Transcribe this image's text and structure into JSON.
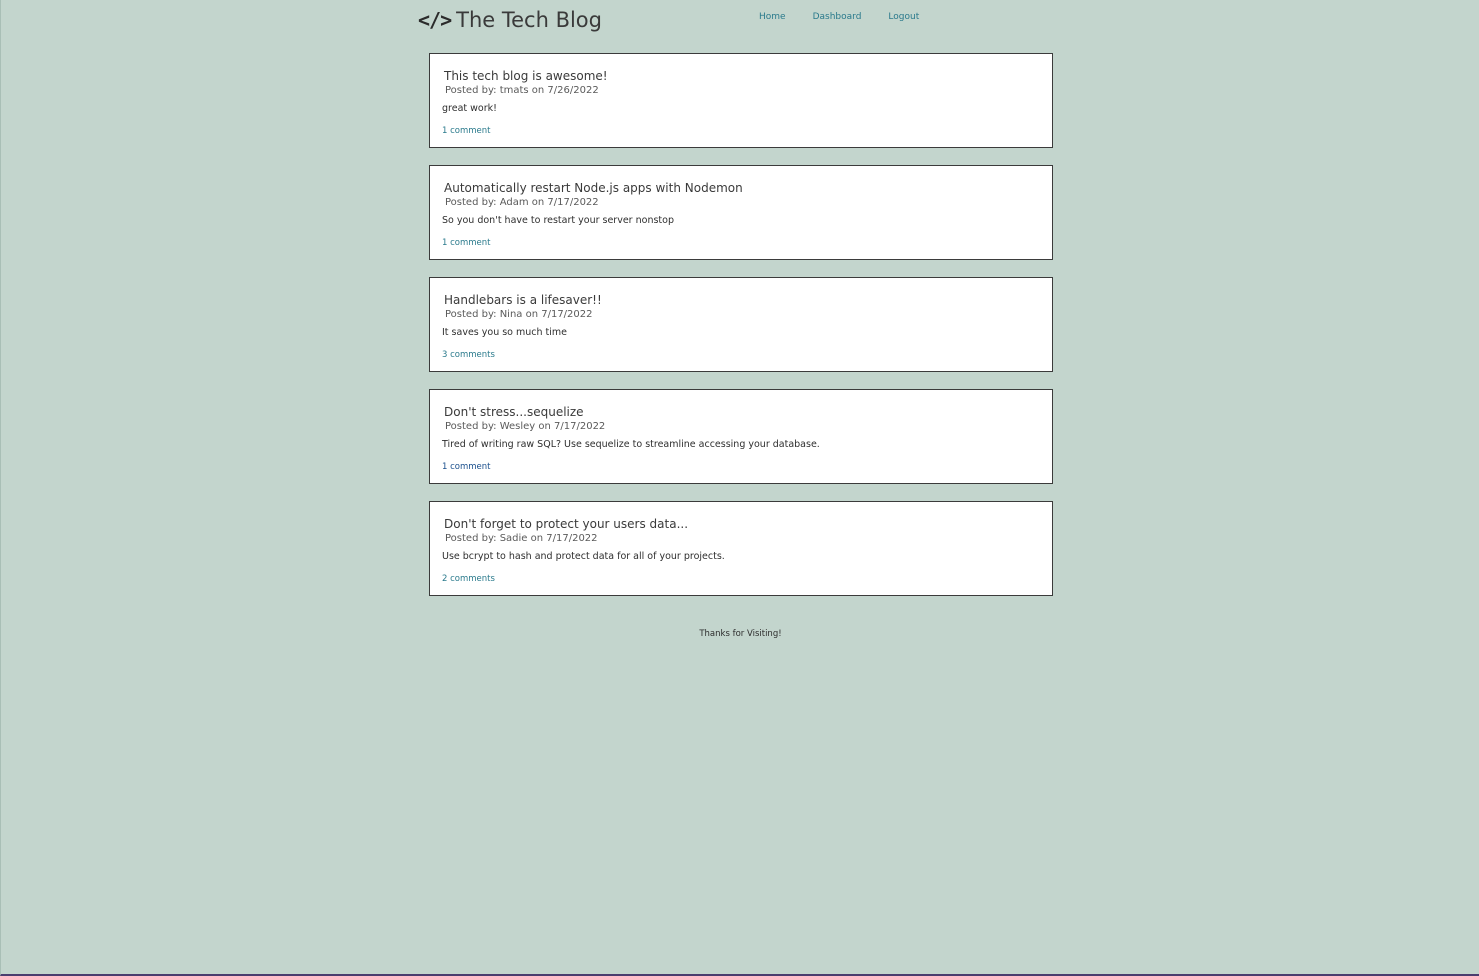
{
  "header": {
    "brand_icon": "</>",
    "title": "The Tech Blog",
    "nav": [
      {
        "label": "Home"
      },
      {
        "label": "Dashboard"
      },
      {
        "label": "Logout"
      }
    ]
  },
  "posts": [
    {
      "title": "This tech blog is awesome!",
      "meta": "Posted by: tmats on 7/26/2022",
      "body": "great work!",
      "comments": "1 comment"
    },
    {
      "title": "Automatically restart Node.js apps with Nodemon",
      "meta": "Posted by: Adam on 7/17/2022",
      "body": "So you don't have to restart your server nonstop",
      "comments": "1 comment"
    },
    {
      "title": "Handlebars is a lifesaver!!",
      "meta": "Posted by: Nina on 7/17/2022",
      "body": "It saves you so much time",
      "comments": "3 comments"
    },
    {
      "title": "Don't stress...sequelize",
      "meta": "Posted by: Wesley on 7/17/2022",
      "body": "Tired of writing raw SQL? Use sequelize to streamline accessing your database.",
      "comments": "1 comment"
    },
    {
      "title": "Don't forget to protect your users data...",
      "meta": "Posted by: Sadie on 7/17/2022",
      "body": "Use bcrypt to hash and protect data for all of your projects.",
      "comments": "2 comments"
    }
  ],
  "footer": {
    "text": "Thanks for Visiting!"
  }
}
